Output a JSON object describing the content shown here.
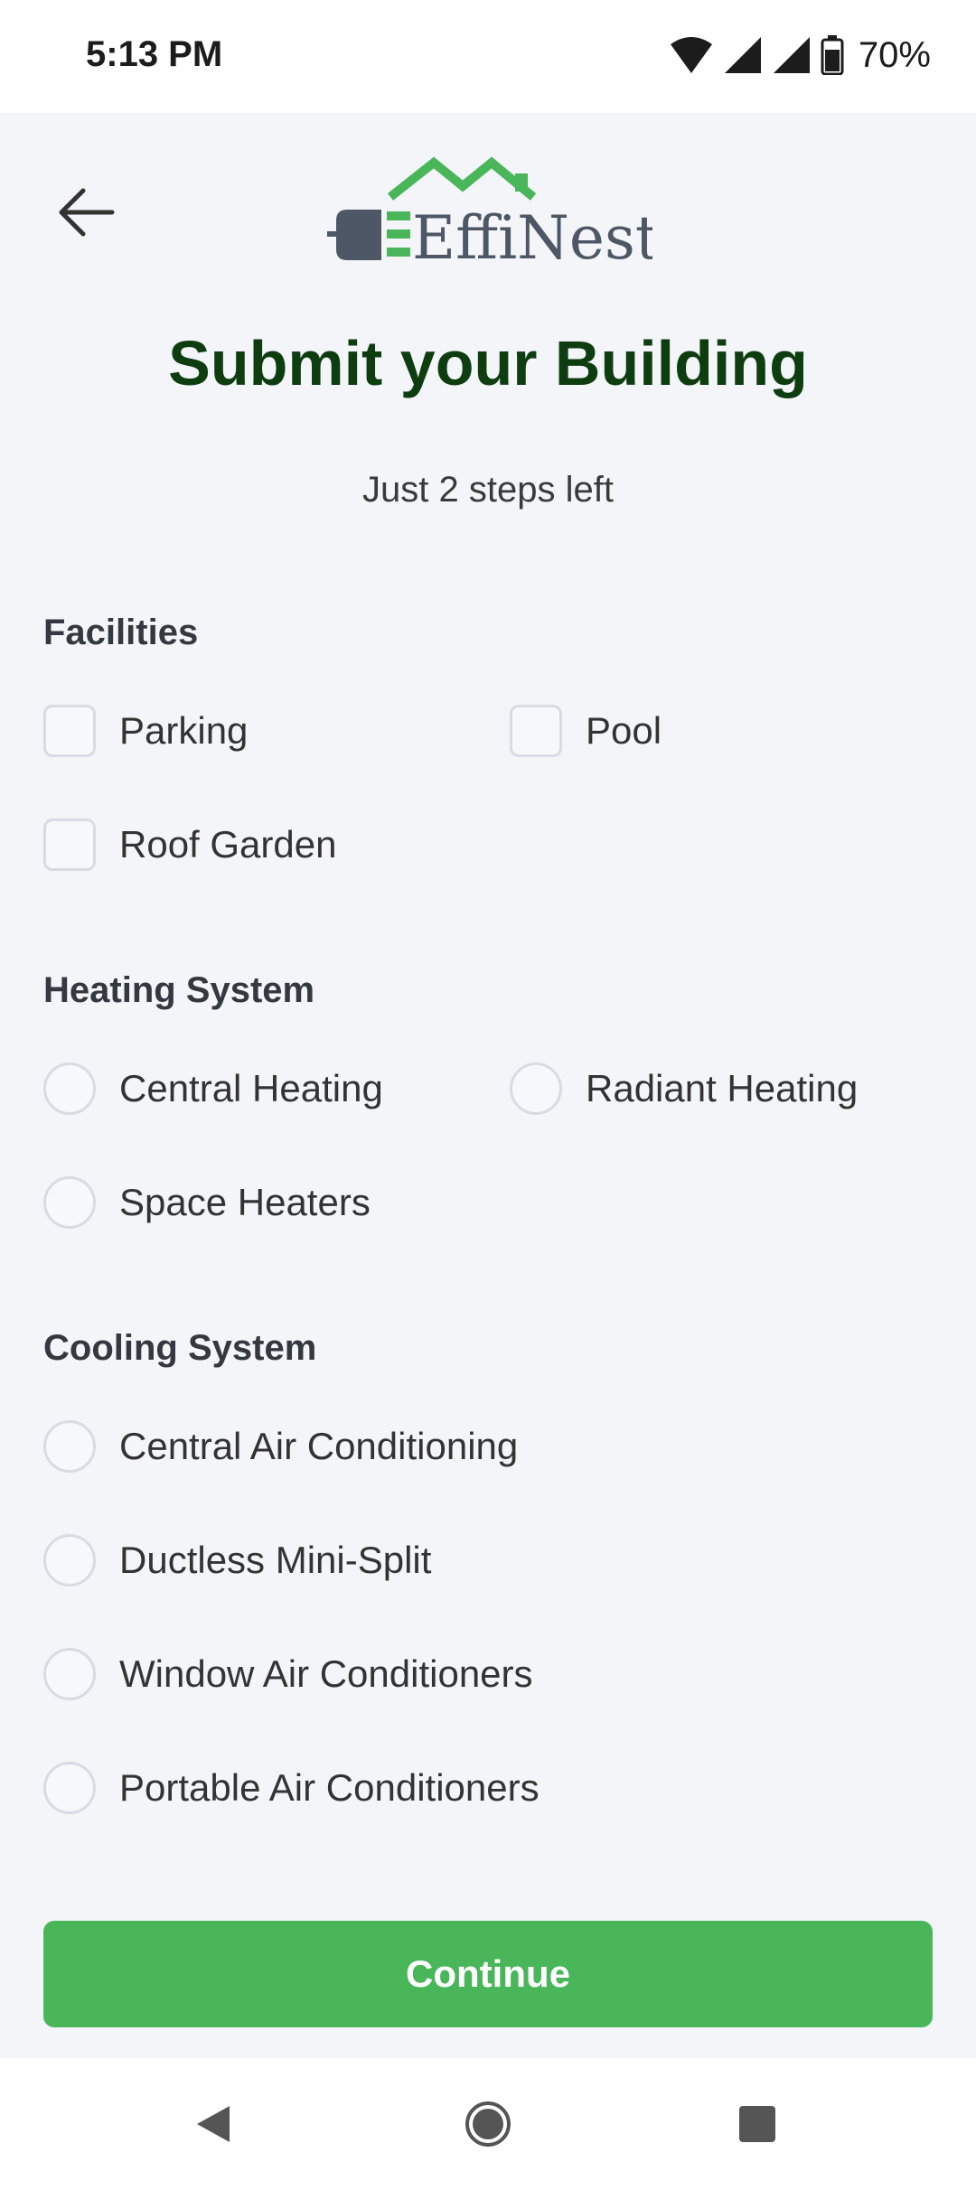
{
  "status": {
    "time": "5:13 PM",
    "battery": "70%"
  },
  "header": {
    "logo_text": "EffiNest",
    "title": "Submit your Building",
    "subtitle": "Just 2 steps left"
  },
  "facilities": {
    "title": "Facilities",
    "options": [
      "Parking",
      "Pool",
      "Roof Garden"
    ]
  },
  "heating": {
    "title": "Heating System",
    "options": [
      "Central Heating",
      "Radiant Heating",
      "Space Heaters"
    ]
  },
  "cooling": {
    "title": "Cooling System",
    "options": [
      "Central Air Conditioning",
      "Ductless Mini-Split",
      "Window Air Conditioners",
      "Portable Air Conditioners"
    ]
  },
  "actions": {
    "continue_label": "Continue"
  },
  "colors": {
    "accent": "#4ab65a",
    "title": "#0e3d10",
    "logo_dark": "#4d5765"
  },
  "icons": [
    "back-arrow-icon",
    "wifi-icon",
    "signal-icon",
    "battery-icon",
    "nav-back-icon",
    "nav-home-icon",
    "nav-recents-icon"
  ]
}
